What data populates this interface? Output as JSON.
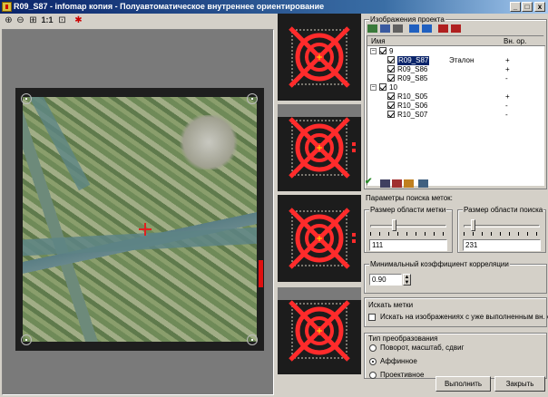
{
  "window": {
    "title": "R09_S87 - infomap копия - Полуавтоматическое внутреннее ориентирование",
    "controls": [
      "_",
      "□",
      "x"
    ]
  },
  "toolbar": {
    "zoom_in_icon": "zoom-in-icon",
    "zoom_out_icon": "zoom-out-icon",
    "zoom_fit_icon": "zoom-fit-icon",
    "one_to_one": "1:1",
    "extent_icon": "extent-icon",
    "pick_icon": "pick-icon"
  },
  "project": {
    "group_label": "Изображения проекта",
    "columns": [
      "Имя",
      "",
      "Вн. ор."
    ],
    "groups": [
      {
        "name": "9",
        "items": [
          {
            "name": "R09_S87",
            "tag": "Эталон",
            "status": "+",
            "selected": true
          },
          {
            "name": "R09_S86",
            "tag": "",
            "status": "+"
          },
          {
            "name": "R09_S85",
            "tag": "",
            "status": "-"
          }
        ]
      },
      {
        "name": "10",
        "items": [
          {
            "name": "R10_S05",
            "tag": "",
            "status": "+"
          },
          {
            "name": "R10_S06",
            "tag": "",
            "status": "-"
          },
          {
            "name": "R10_S07",
            "tag": "",
            "status": "-"
          }
        ]
      }
    ]
  },
  "search": {
    "heading": "Параметры поиска меток:",
    "mark_size_label": "Размер области метки",
    "mark_size_value": "111",
    "mark_size_level": 0.3,
    "area_size_label": "Размер области поиска",
    "area_size_value": "231",
    "area_size_level": 0.1,
    "corr_label": "Минимальный коэффициент корреляции",
    "corr_value": "0.90"
  },
  "find": {
    "group_label": "Искать метки",
    "checkbox_label": "Искать на изображениях  с уже выполненным вн. ор-ем",
    "checked": false
  },
  "transform": {
    "group_label": "Тип преобразования",
    "options": [
      "Поворот, масштаб, сдвиг",
      "Аффинное",
      "Проективное"
    ],
    "selected": "Аффинное"
  },
  "buttons": {
    "run": "Выполнить",
    "close": "Закрыть"
  },
  "colors": {
    "marker": "#ff2b2b",
    "selection": "#0a246a",
    "titlebar": "#0a246a"
  }
}
